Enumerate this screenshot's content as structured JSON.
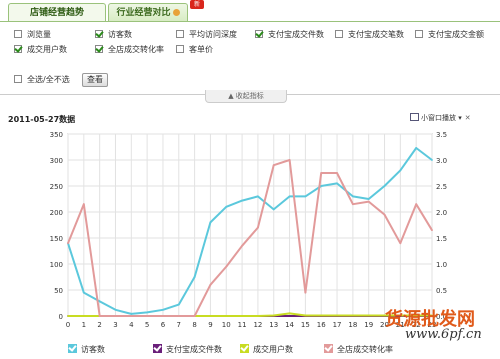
{
  "tabs": [
    {
      "label": "店铺经营趋势",
      "active": true
    },
    {
      "label": "行业经营对比",
      "active": false
    }
  ],
  "new_badge": "新",
  "options": [
    {
      "label": "浏览量",
      "checked": false
    },
    {
      "label": "访客数",
      "checked": true
    },
    {
      "label": "平均访问深度",
      "checked": false
    },
    {
      "label": "支付宝成交件数",
      "checked": true
    },
    {
      "label": "支付宝成交笔数",
      "checked": false
    },
    {
      "label": "支付宝成交金额",
      "checked": false
    },
    {
      "label": "成交用户数",
      "checked": true
    },
    {
      "label": "全店成交转化率",
      "checked": true
    },
    {
      "label": "客单价",
      "checked": false
    }
  ],
  "select_all_label": "全选/全不选",
  "query_button": "查看",
  "collapse_label": "收起指标",
  "date_title": "2011-05-27数据",
  "popout_label": "小窗口播放",
  "colors": {
    "visitors": "#5bc8dc",
    "alipay_items": "#6a1f7a",
    "buyers": "#c8dc22",
    "conversion": "#e29a9a",
    "accent": "#9ac27b"
  },
  "chart_data": {
    "type": "line",
    "x": [
      0,
      1,
      2,
      3,
      4,
      5,
      6,
      7,
      8,
      9,
      10,
      11,
      12,
      13,
      14,
      15,
      16,
      17,
      18,
      19,
      20,
      21,
      22,
      23
    ],
    "ylim_left": [
      0,
      350
    ],
    "yticks_left": [
      0,
      50,
      100,
      150,
      200,
      250,
      300,
      350
    ],
    "ylim_right": [
      0,
      3.5
    ],
    "yticks_right": [
      0,
      0.5,
      1.0,
      1.5,
      2.0,
      2.5,
      3.0,
      3.5
    ],
    "grid": true,
    "series": [
      {
        "name": "访客数",
        "axis": "left",
        "color": "#5bc8dc",
        "values": [
          140,
          45,
          28,
          12,
          4,
          7,
          12,
          22,
          75,
          180,
          210,
          222,
          230,
          205,
          230,
          230,
          250,
          255,
          230,
          225,
          250,
          280,
          323,
          300
        ]
      },
      {
        "name": "支付宝成交件数",
        "axis": "left",
        "color": "#6a1f7a",
        "values": [
          0,
          0,
          0,
          0,
          0,
          0,
          0,
          0,
          0,
          0,
          0,
          0,
          0,
          0,
          0,
          0,
          0,
          0,
          0,
          0,
          0,
          0,
          0,
          0
        ]
      },
      {
        "name": "成交用户数",
        "axis": "left",
        "color": "#c8dc22",
        "values": [
          0,
          0,
          0,
          0,
          0,
          0,
          0,
          0,
          0,
          0,
          0,
          0,
          0,
          1,
          5,
          1,
          1,
          1,
          1,
          1,
          1,
          1,
          1,
          1
        ]
      },
      {
        "name": "全店成交转化率",
        "axis": "right",
        "color": "#e29a9a",
        "values": [
          1.4,
          2.15,
          0,
          0,
          0,
          0,
          0,
          0,
          0,
          0.6,
          0.95,
          1.35,
          1.7,
          2.9,
          3.0,
          0.45,
          2.75,
          2.75,
          2.15,
          2.2,
          1.95,
          1.4,
          2.15,
          1.65
        ]
      }
    ]
  },
  "legend": [
    {
      "label": "访客数",
      "color": "#5bc8dc"
    },
    {
      "label": "支付宝成交件数",
      "color": "#6a1f7a"
    },
    {
      "label": "成交用户数",
      "color": "#c8dc22"
    },
    {
      "label": "全店成交转化率",
      "color": "#e29a9a"
    }
  ],
  "watermark": {
    "line1": "货源批发网",
    "line2": "www.6pf.cn"
  }
}
